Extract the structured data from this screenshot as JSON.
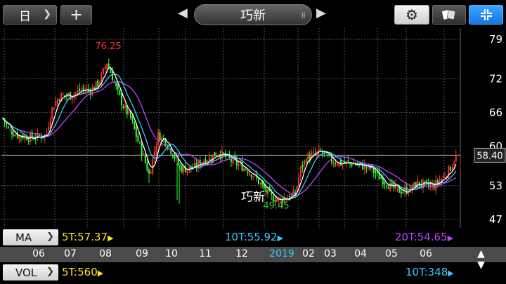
{
  "header": {
    "period_label": "日",
    "add_label": "+",
    "prev_label": "◀",
    "next_label": "▶",
    "title": "巧新",
    "handle_icon": "⁞⁞",
    "gear_icon": "⚙",
    "card_icon": "▭",
    "expand_icon": "⊹"
  },
  "chart_data": {
    "type": "candlestick-line",
    "watermark": "巧新",
    "y_axis_ticks": [
      "79",
      "72",
      "66",
      "60",
      "53",
      "47"
    ],
    "y_axis_values": [
      79,
      72,
      66,
      60,
      53,
      47
    ],
    "ylim": [
      45.5,
      81
    ],
    "current_price_label": "58.40",
    "current_price": 58.4,
    "high_label": "76.25",
    "high_value": 76.25,
    "low_label": "49.45",
    "low_value": 49.45,
    "x_axis_months": [
      "06",
      "07",
      "08",
      "09",
      "10",
      "11",
      "12",
      "2019",
      "02",
      "03",
      "04",
      "05",
      "06"
    ],
    "highlight_month": "2019",
    "series_colors": {
      "up_candle": "#ff3030",
      "down_candle": "#30ff30",
      "ma5": "#ffffff",
      "ma10": "#3cc8ff",
      "ma20": "#c040ff",
      "ma60": "#ffe030"
    }
  },
  "ma_row": {
    "dropdown_label": "MA",
    "ma5_label": "5T:57.37",
    "ma10_label": "10T:55.92",
    "ma20_label": "20T:54.65",
    "arrow": "▶"
  },
  "vol_row": {
    "dropdown_label": "VOL",
    "vol5_label": "5T:560",
    "vol10_label": "10T:348",
    "arrow": "▶"
  },
  "sort_icon": "▲▼"
}
